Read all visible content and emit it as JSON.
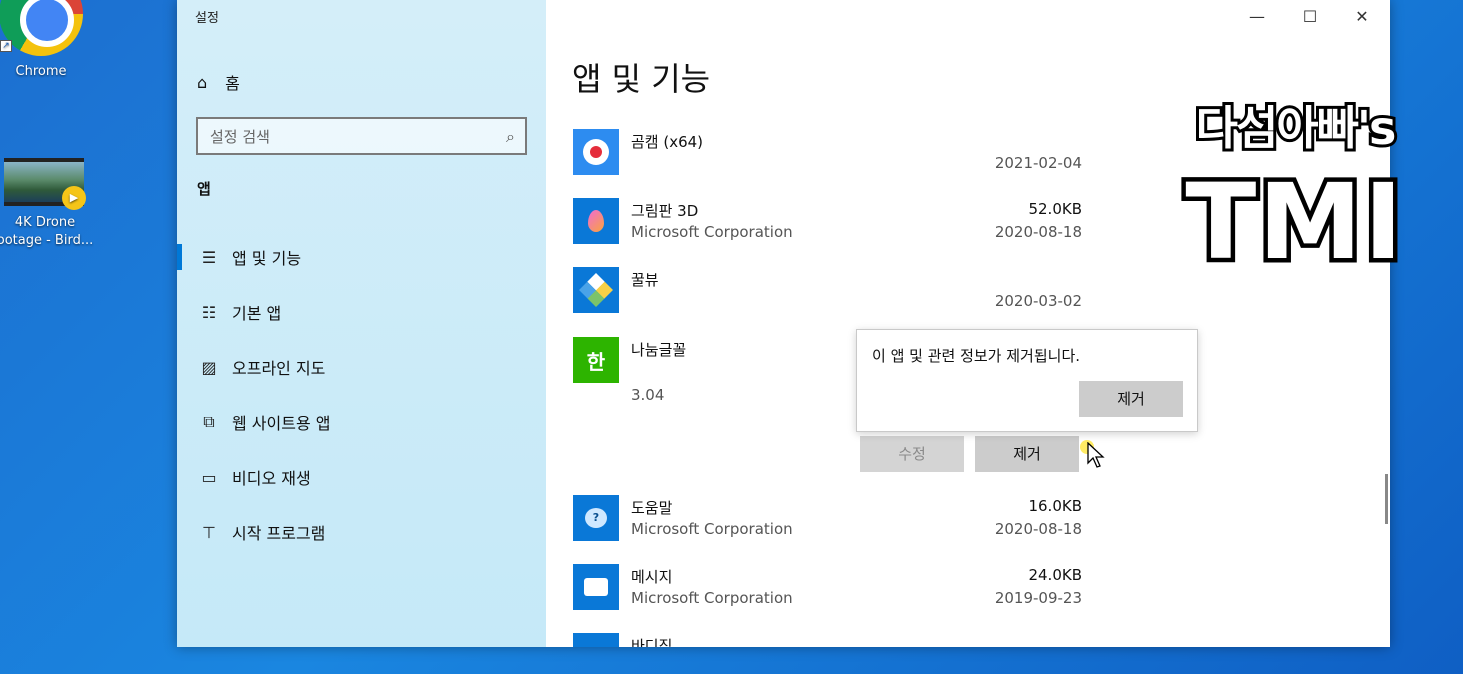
{
  "desktop": {
    "icons": [
      {
        "label": "Chrome",
        "icon": "chrome-icon"
      },
      {
        "label_line1": "4K Drone",
        "label_line2": "ootage - Bird...",
        "icon": "video-file-icon"
      }
    ]
  },
  "window": {
    "title": "설정",
    "controls": {
      "minimize": "—",
      "maximize": "☐",
      "close": "✕"
    }
  },
  "sidebar": {
    "home": {
      "label": "홈",
      "icon": "home-icon"
    },
    "search": {
      "placeholder": "설정 검색",
      "icon": "search-icon"
    },
    "section": "앱",
    "items": [
      {
        "label": "앱 및 기능",
        "icon": "list-icon",
        "active": true
      },
      {
        "label": "기본 앱",
        "icon": "default-apps-icon",
        "active": false
      },
      {
        "label": "오프라인 지도",
        "icon": "map-icon",
        "active": false
      },
      {
        "label": "웹 사이트용 앱",
        "icon": "open-in-window-icon",
        "active": false
      },
      {
        "label": "비디오 재생",
        "icon": "video-icon",
        "active": false
      },
      {
        "label": "시작 프로그램",
        "icon": "startup-icon",
        "active": false
      }
    ]
  },
  "main": {
    "title": "앱 및 기능",
    "apps": [
      {
        "name": "곰캠 (x64)",
        "publisher": "",
        "size": "",
        "date": "2021-02-04",
        "icon": "gomcam-icon",
        "icon_color": "#2d8cf0"
      },
      {
        "name": "그림판 3D",
        "publisher": "Microsoft Corporation",
        "size": "52.0KB",
        "date": "2020-08-18",
        "icon": "paint3d-icon",
        "icon_color": "#0a78d7"
      },
      {
        "name": "꿀뷰",
        "publisher": "",
        "size": "",
        "date": "2020-03-02",
        "icon": "honeyview-icon",
        "icon_color": "#0a78d7"
      },
      {
        "name": "나눔글꼴",
        "publisher": "",
        "version": "3.04",
        "icon": "nanum-font-icon",
        "icon_color": "#2db400"
      },
      {
        "name": "도움말",
        "publisher": "Microsoft Corporation",
        "size": "16.0KB",
        "date": "2020-08-18",
        "icon": "help-icon",
        "icon_color": "#0a78d7"
      },
      {
        "name": "메시지",
        "publisher": "Microsoft Corporation",
        "size": "24.0KB",
        "date": "2019-09-23",
        "icon": "messaging-icon",
        "icon_color": "#0a78d7"
      },
      {
        "name": "바디짐",
        "icon": "app-icon",
        "icon_color": "#0a78d7"
      }
    ],
    "selected_actions": {
      "modify": "수정",
      "uninstall": "제거"
    },
    "flyout": {
      "message": "이 앱 및 관련 정보가 제거됩니다.",
      "confirm": "제거"
    }
  },
  "watermark": {
    "line1": "다섬아빠's",
    "line2": "TMI"
  }
}
